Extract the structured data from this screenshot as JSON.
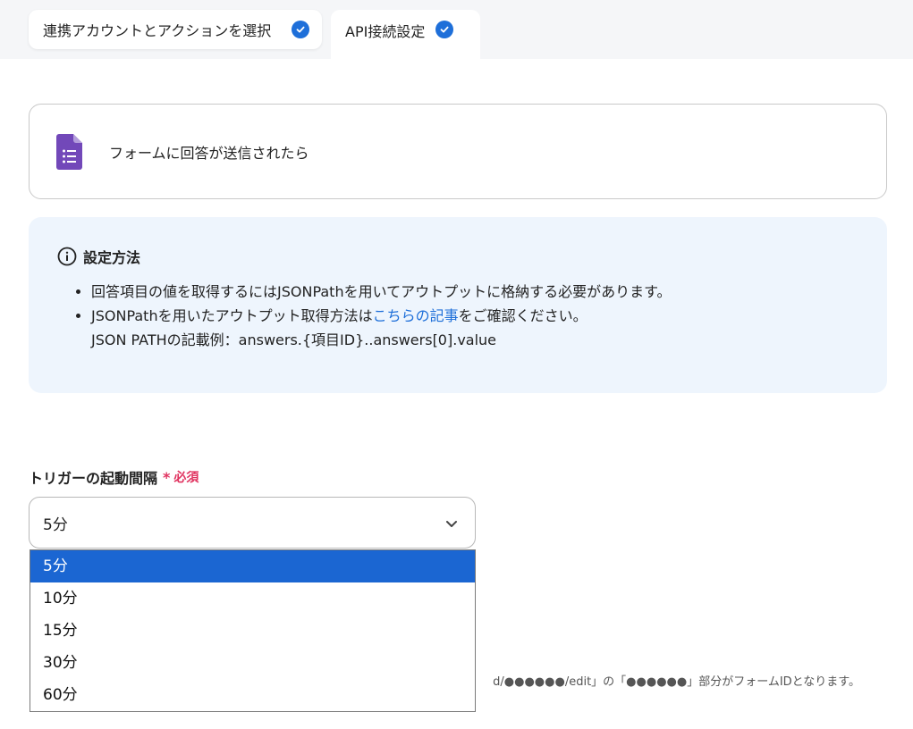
{
  "tabs": [
    {
      "label": "連携アカウントとアクションを選択",
      "completed": true
    },
    {
      "label": "API接続設定",
      "completed": true
    }
  ],
  "app_card": {
    "icon": "google-forms-icon",
    "title": "フォームに回答が送信されたら"
  },
  "info": {
    "heading": "設定方法",
    "bullet1": "回答項目の値を取得するにはJSONPathを用いてアウトプットに格納する必要があります。",
    "bullet2_prefix": "JSONPathを用いたアウトプット取得方法は",
    "bullet2_link": "こちらの記事",
    "bullet2_suffix": "をご確認ください。",
    "bullet2_example": "JSON PATHの記載例：answers.{項目ID}..answers[0].value"
  },
  "trigger_field": {
    "label": "トリガーの起動間隔",
    "required_mark": "*",
    "required_text": "必須",
    "selected": "5分",
    "options": [
      "5分",
      "10分",
      "15分",
      "30分",
      "60分"
    ]
  },
  "hint_text": "d/●●●●●●/edit」の「●●●●●●」部分がフォームIDとなります。",
  "colors": {
    "accent": "#1e6fd9",
    "required": "#e0325f",
    "info_bg": "#eef5fd",
    "selected_option": "#1b66d2",
    "forms_purple": "#7248b9"
  }
}
